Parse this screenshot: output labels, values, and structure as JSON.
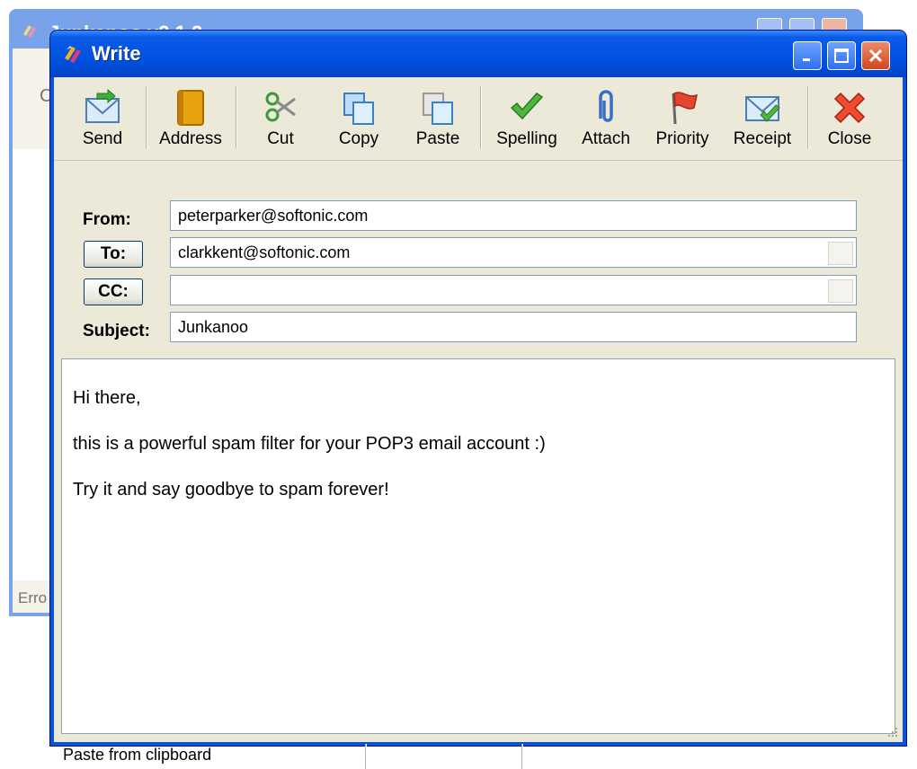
{
  "background_window": {
    "title": "Junkanoo v2.1.2",
    "toolbar_label": "Ch",
    "status": "Erro"
  },
  "window": {
    "title": "Write",
    "title_logo_icon": "junkanoo-logo-icon",
    "controls": [
      "minimize-icon",
      "maximize-icon",
      "close-icon"
    ]
  },
  "toolbar": {
    "send": "Send",
    "address": "Address",
    "cut": "Cut",
    "copy": "Copy",
    "paste": "Paste",
    "spelling": "Spelling",
    "attach": "Attach",
    "priority": "Priority",
    "receipt": "Receipt",
    "close": "Close"
  },
  "header": {
    "from_label": "From:",
    "from_value": "peterparker@softonic.com",
    "to_button": "To:",
    "to_value": "clarkkent@softonic.com",
    "cc_button": "CC:",
    "cc_value": "",
    "subject_label": "Subject:",
    "subject_value": "Junkanoo"
  },
  "body": {
    "lines": [
      "Hi there,",
      "this is a powerful spam filter for your POP3 email account :)",
      "Try it and say goodbye to spam forever!"
    ]
  },
  "status": {
    "text": "Paste from clipboard"
  },
  "colors": {
    "titlebar": "#0152e0",
    "client": "#ece9d8",
    "field_border": "#7f9db9"
  }
}
